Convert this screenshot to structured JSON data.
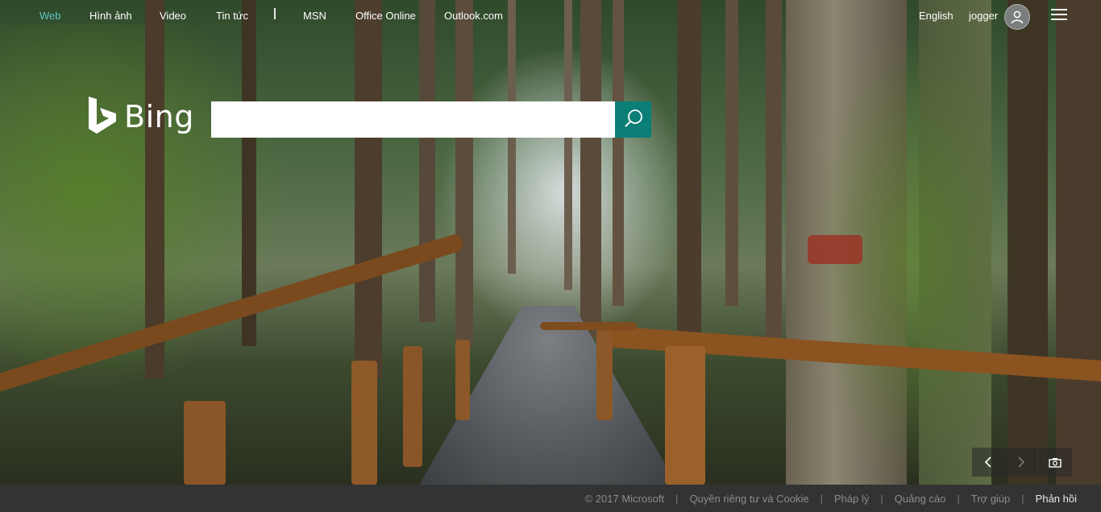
{
  "header": {
    "nav": [
      {
        "label": "Web",
        "active": true
      },
      {
        "label": "Hình ảnh",
        "active": false
      },
      {
        "label": "Video",
        "active": false
      },
      {
        "label": "Tin tức",
        "active": false
      },
      {
        "label": "MSN",
        "active": false
      },
      {
        "label": "Office Online",
        "active": false
      },
      {
        "label": "Outlook.com",
        "active": false
      }
    ],
    "language": "English",
    "username": "jogger",
    "avatar_icon": "user-icon",
    "menu_icon": "hamburger-menu-icon"
  },
  "search": {
    "logo_text": "Bing",
    "logo_icon": "bing-logo-icon",
    "placeholder": "",
    "value": "",
    "button_icon": "search-icon",
    "accent_color": "#0b7e76"
  },
  "image_controls": {
    "prev_icon": "chevron-left-icon",
    "next_icon": "chevron-right-icon",
    "camera_icon": "camera-icon"
  },
  "footer": {
    "items": [
      {
        "label": "© 2017 Microsoft"
      },
      {
        "label": "Quyền riêng tư và Cookie"
      },
      {
        "label": "Pháp lý"
      },
      {
        "label": "Quảng cáo"
      },
      {
        "label": "Trợ giúp"
      },
      {
        "label": "Phản hồi"
      }
    ],
    "background": "#333333"
  }
}
